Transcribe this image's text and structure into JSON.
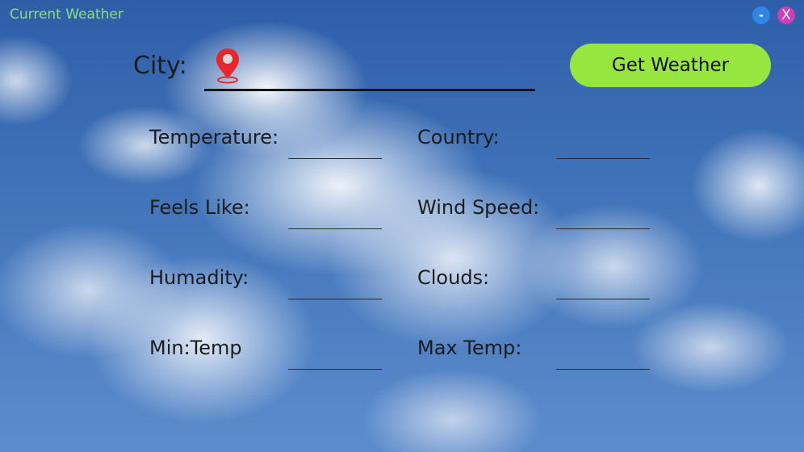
{
  "window": {
    "title": "Current Weather",
    "minimize_label": "-",
    "close_label": "X"
  },
  "search": {
    "city_label": "City:",
    "city_value": "",
    "city_placeholder": "",
    "button_label": "Get Weather",
    "pin_icon": "location-pin-icon"
  },
  "fields": {
    "temperature": {
      "label": "Temperature:",
      "value": ""
    },
    "country": {
      "label": "Country:",
      "value": ""
    },
    "feels_like": {
      "label": "Feels Like:",
      "value": ""
    },
    "wind_speed": {
      "label": "Wind Speed:",
      "value": ""
    },
    "humidity": {
      "label": "Humadity:",
      "value": ""
    },
    "clouds": {
      "label": "Clouds:",
      "value": ""
    },
    "min_temp": {
      "label": "Min:Temp",
      "value": ""
    },
    "max_temp": {
      "label": "Max Temp:",
      "value": ""
    }
  },
  "colors": {
    "title_text": "#86e07a",
    "button_bg": "#97e63f",
    "minimize_bg": "#2f86e6",
    "close_bg": "#cc3fb6",
    "pin": "#e8262d"
  }
}
